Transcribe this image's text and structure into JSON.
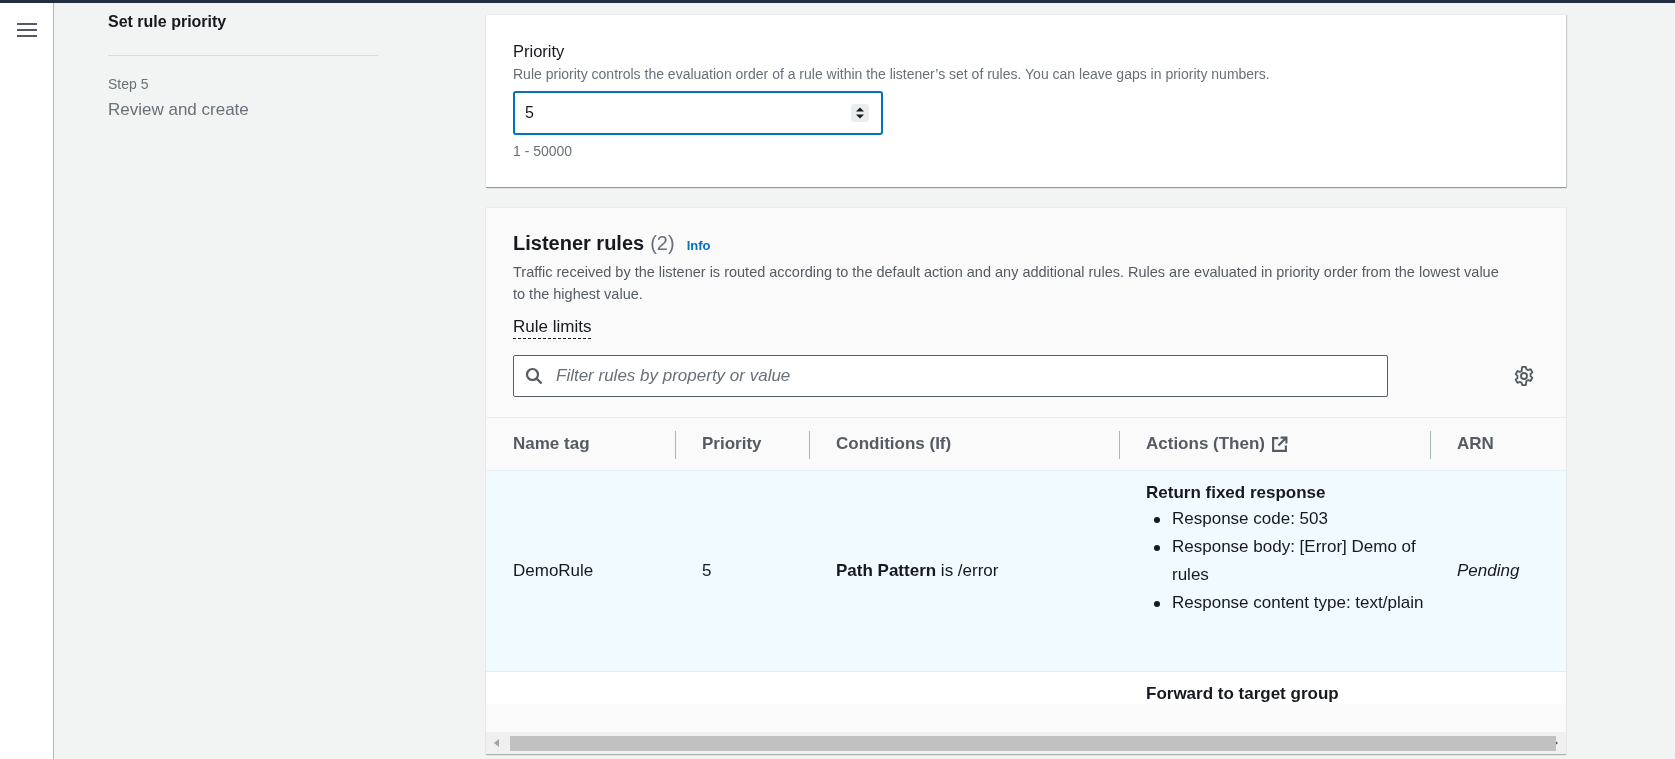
{
  "steps": [
    {
      "title": "Set rule priority",
      "current": true
    },
    {
      "label": "Step 5",
      "title": "Review and create",
      "current": false
    }
  ],
  "priority": {
    "label": "Priority",
    "description": "Rule priority controls the evaluation order of a rule within the listener’s set of rules. You can leave gaps in priority numbers.",
    "value": "5",
    "hint": "1 - 50000"
  },
  "listener_rules": {
    "title": "Listener rules",
    "count": "(2)",
    "info": "Info",
    "description": "Traffic received by the listener is routed according to the default action and any additional rules. Rules are evaluated in priority order from the lowest value to the highest value.",
    "limits": "Rule limits",
    "filter": {
      "placeholder": "Filter rules by property or value"
    },
    "columns": [
      {
        "label": "Name tag",
        "external": false
      },
      {
        "label": "Priority",
        "external": false
      },
      {
        "label": "Conditions (If)",
        "external": false
      },
      {
        "label": "Actions (Then)",
        "external": true
      },
      {
        "label": "ARN",
        "external": false
      }
    ],
    "rows": [
      {
        "selected": true,
        "name_tag": "DemoRule",
        "priority": "5",
        "condition": "**Path Pattern** is /error",
        "action_title": "Return fixed response",
        "action_items": [
          "Response code: 503",
          "Response body: [Error] Demo of rules",
          "Response content type: text/plain"
        ],
        "arn": "Pending"
      },
      {
        "selected": false,
        "action_title": "Forward to target group"
      }
    ]
  }
}
